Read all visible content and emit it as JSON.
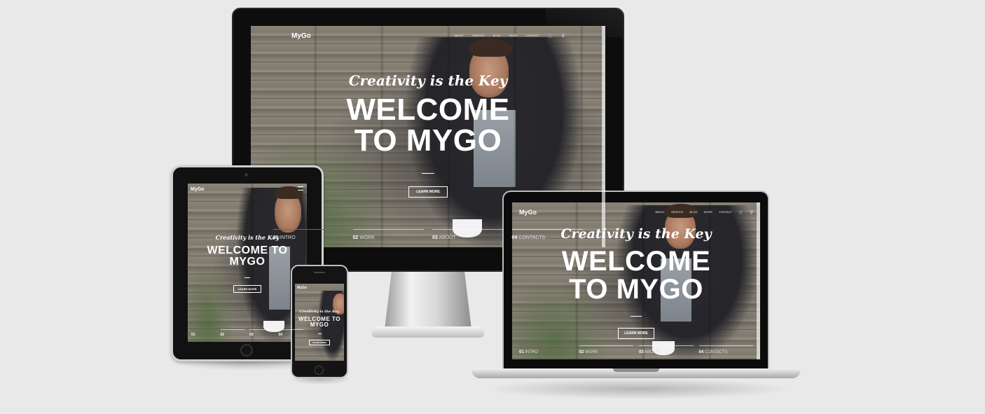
{
  "site": {
    "logo": "MyGo",
    "tagline": "Creativity is the Key",
    "headline": "WELCOME TO MYGO",
    "headline_line1": "WELCOME",
    "headline_line2": "TO MYGO",
    "cta": "LEARN MORE",
    "nav": [
      "ABOUT",
      "SERVICE",
      "BLOG",
      "WORK",
      "CONTACT"
    ],
    "slides": [
      {
        "num": "01",
        "label": "INTRO"
      },
      {
        "num": "02",
        "label": "WORK"
      },
      {
        "num": "03",
        "label": "ABOUT"
      },
      {
        "num": "04",
        "label": "CONTACTS"
      }
    ]
  },
  "icons": {
    "cart": "cart-icon",
    "search": "search-icon",
    "menu": "hamburger-menu-icon"
  },
  "colors": {
    "background": "#e9e9e9",
    "active_slide": "#e03a3a",
    "text": "#ffffff"
  }
}
